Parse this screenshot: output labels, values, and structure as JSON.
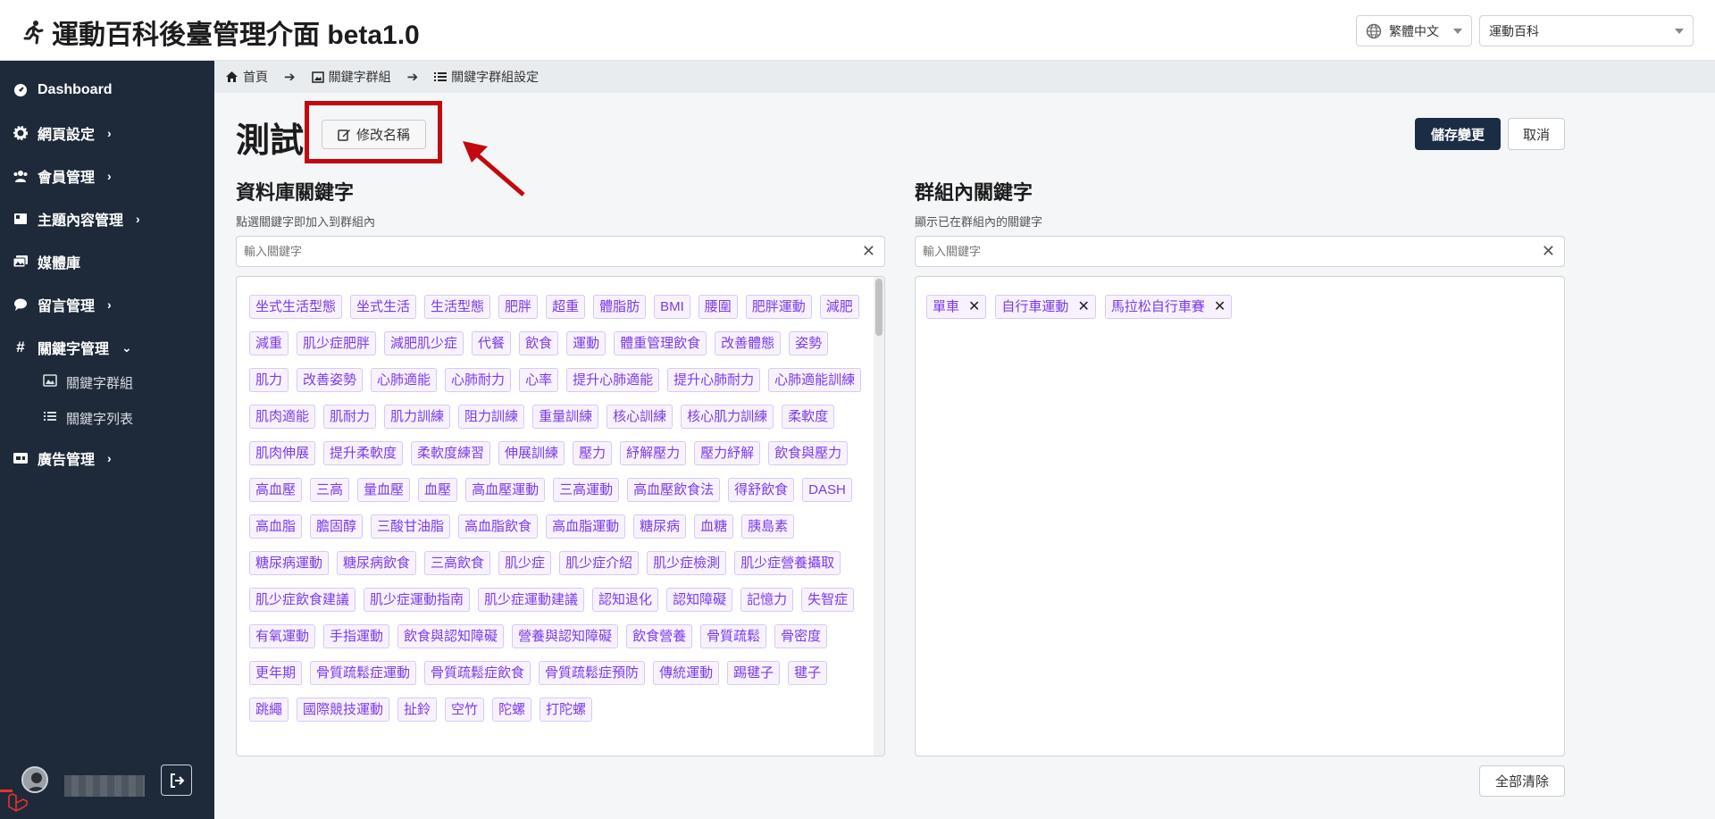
{
  "header": {
    "app_title": "運動百科後臺管理介面 beta1.0",
    "language": "繁體中文",
    "site": "運動百科"
  },
  "sidebar": {
    "items": [
      {
        "label": "Dashboard",
        "icon": "gauge-icon"
      },
      {
        "label": "網頁設定",
        "icon": "gear-icon",
        "chevron": "›"
      },
      {
        "label": "會員管理",
        "icon": "users-icon",
        "chevron": "›"
      },
      {
        "label": "主題內容管理",
        "icon": "book-icon",
        "chevron": "›"
      },
      {
        "label": "媒體庫",
        "icon": "images-icon"
      },
      {
        "label": "留言管理",
        "icon": "comment-icon",
        "chevron": "›"
      },
      {
        "label": "關鍵字管理",
        "icon": "hashtag-icon",
        "chevron": "⌄"
      },
      {
        "label": "廣告管理",
        "icon": "ad-icon",
        "chevron": "›"
      }
    ],
    "sub_items": [
      {
        "label": "關鍵字群組",
        "icon": "image-icon"
      },
      {
        "label": "關鍵字列表",
        "icon": "list-icon"
      }
    ]
  },
  "breadcrumb": [
    {
      "label": "首頁",
      "icon": "home-icon"
    },
    {
      "label": "關鍵字群組",
      "icon": "image-icon"
    },
    {
      "label": "關鍵字群組設定",
      "icon": "list-icon"
    }
  ],
  "page": {
    "title": "測試",
    "rename_label": "修改名稱",
    "save_label": "儲存變更",
    "cancel_label": "取消",
    "clear_all_label": "全部清除"
  },
  "left_panel": {
    "title": "資料庫關鍵字",
    "subtitle": "點選關鍵字即加入到群組內",
    "placeholder": "輸入關鍵字",
    "keywords": [
      "坐式生活型態",
      "坐式生活",
      "生活型態",
      "肥胖",
      "超重",
      "體脂肪",
      "BMI",
      "腰圍",
      "肥胖運動",
      "減肥",
      "減重",
      "肌少症肥胖",
      "減肥肌少症",
      "代餐",
      "飲食",
      "運動",
      "體重管理飲食",
      "改善體態",
      "姿勢",
      "肌力",
      "改善姿勢",
      "心肺適能",
      "心肺耐力",
      "心率",
      "提升心肺適能",
      "提升心肺耐力",
      "心肺適能訓練",
      "肌肉適能",
      "肌耐力",
      "肌力訓練",
      "阻力訓練",
      "重量訓練",
      "核心訓練",
      "核心肌力訓練",
      "柔軟度",
      "肌肉伸展",
      "提升柔軟度",
      "柔軟度練習",
      "伸展訓練",
      "壓力",
      "紓解壓力",
      "壓力紓解",
      "飲食與壓力",
      "高血壓",
      "三高",
      "量血壓",
      "血壓",
      "高血壓運動",
      "三高運動",
      "高血壓飲食法",
      "得舒飲食",
      "DASH",
      "高血脂",
      "膽固醇",
      "三酸甘油脂",
      "高血脂飲食",
      "高血脂運動",
      "糖尿病",
      "血糖",
      "胰島素",
      "糖尿病運動",
      "糖尿病飲食",
      "三高飲食",
      "肌少症",
      "肌少症介紹",
      "肌少症檢測",
      "肌少症營養攝取",
      "肌少症飲食建議",
      "肌少症運動指南",
      "肌少症運動建議",
      "認知退化",
      "認知障礙",
      "記憶力",
      "失智症",
      "有氧運動",
      "手指運動",
      "飲食與認知障礙",
      "營養與認知障礙",
      "飲食營養",
      "骨質疏鬆",
      "骨密度",
      "更年期",
      "骨質疏鬆症運動",
      "骨質疏鬆症飲食",
      "骨質疏鬆症預防",
      "傳統運動",
      "踢毽子",
      "毽子",
      "跳繩",
      "國際競技運動",
      "扯鈴",
      "空竹",
      "陀螺",
      "打陀螺"
    ]
  },
  "right_panel": {
    "title": "群組內關鍵字",
    "subtitle": "顯示已在群組內的關鍵字",
    "placeholder": "輸入關鍵字",
    "selected": [
      "單車",
      "自行車運動",
      "馬拉松自行車賽"
    ]
  },
  "colors": {
    "sidebar_bg": "#1e2a3a",
    "primary_button": "#1b2d45",
    "tag_text": "#7c3aed",
    "annotation_red": "#c4080f"
  }
}
